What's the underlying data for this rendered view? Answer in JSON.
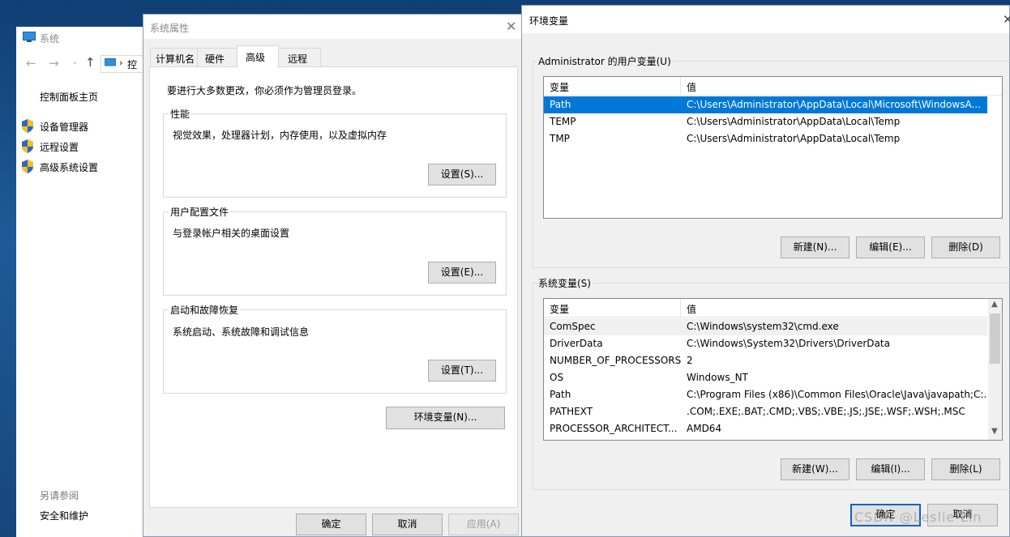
{
  "system_window": {
    "title": "系统",
    "address_trunc": "控",
    "control_panel_home": "控制面板主页",
    "nav": [
      {
        "label": "设备管理器"
      },
      {
        "label": "远程设置"
      },
      {
        "label": "高级系统设置"
      }
    ],
    "see_also": "另请参阅",
    "security_maintenance": "安全和维护"
  },
  "sys_props": {
    "title": "系统属性",
    "tabs": [
      "计算机名",
      "硬件",
      "高级",
      "远程"
    ],
    "active_tab": "高级",
    "admin_note": "要进行大多数更改，你必须作为管理员登录。",
    "performance": {
      "title": "性能",
      "desc": "视觉效果，处理器计划，内存使用，以及虚拟内存",
      "button": "设置(S)..."
    },
    "user_profiles": {
      "title": "用户配置文件",
      "desc": "与登录帐户相关的桌面设置",
      "button": "设置(E)..."
    },
    "startup": {
      "title": "启动和故障恢复",
      "desc": "系统启动、系统故障和调试信息",
      "button": "设置(T)..."
    },
    "env_button": "环境变量(N)...",
    "ok": "确定",
    "cancel": "取消",
    "apply": "应用(A)"
  },
  "env_vars": {
    "title": "环境变量",
    "user_group": "Administrator 的用户变量(U)",
    "col_var": "变量",
    "col_val": "值",
    "user_vars": [
      {
        "name": "Path",
        "value": "C:\\Users\\Administrator\\AppData\\Local\\Microsoft\\WindowsA..."
      },
      {
        "name": "TEMP",
        "value": "C:\\Users\\Administrator\\AppData\\Local\\Temp"
      },
      {
        "name": "TMP",
        "value": "C:\\Users\\Administrator\\AppData\\Local\\Temp"
      }
    ],
    "user_buttons": {
      "new": "新建(N)...",
      "edit": "编辑(E)...",
      "delete": "删除(D)"
    },
    "sys_group": "系统变量(S)",
    "sys_vars": [
      {
        "name": "ComSpec",
        "value": "C:\\Windows\\system32\\cmd.exe"
      },
      {
        "name": "DriverData",
        "value": "C:\\Windows\\System32\\Drivers\\DriverData"
      },
      {
        "name": "NUMBER_OF_PROCESSORS",
        "value": "2"
      },
      {
        "name": "OS",
        "value": "Windows_NT"
      },
      {
        "name": "Path",
        "value": "C:\\Program Files (x86)\\Common Files\\Oracle\\Java\\javapath;C:..."
      },
      {
        "name": "PATHEXT",
        "value": ".COM;.EXE;.BAT;.CMD;.VBS;.VBE;.JS;.JSE;.WSF;.WSH;.MSC"
      },
      {
        "name": "PROCESSOR_ARCHITECT...",
        "value": "AMD64"
      }
    ],
    "sys_buttons": {
      "new": "新建(W)...",
      "edit": "编辑(I)...",
      "delete": "删除(L)"
    },
    "ok": "确定",
    "cancel": "取消"
  },
  "watermark": "CSDN @Leslie-Lin"
}
